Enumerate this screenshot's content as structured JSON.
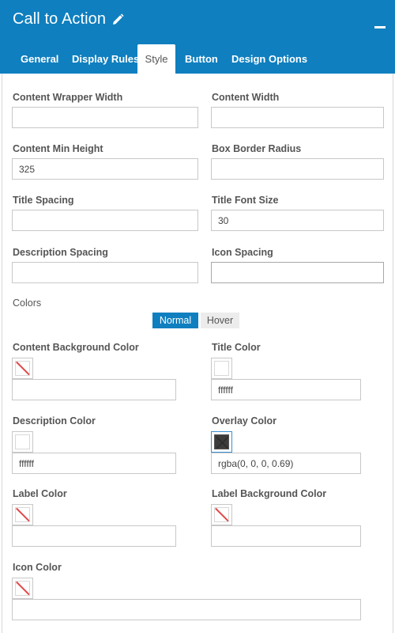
{
  "window": {
    "title": "Call to Action",
    "edit_icon": "pencil-icon",
    "minimize_icon": "minimize-icon"
  },
  "tabs": [
    {
      "label": "General"
    },
    {
      "label": "Display Rules"
    },
    {
      "label": "Style",
      "active": true
    },
    {
      "label": "Button"
    },
    {
      "label": "Design Options"
    }
  ],
  "fields": {
    "content_wrapper_width": {
      "label": "Content Wrapper Width",
      "value": ""
    },
    "content_width": {
      "label": "Content Width",
      "value": ""
    },
    "content_min_height": {
      "label": "Content Min Height",
      "value": "325"
    },
    "box_border_radius": {
      "label": "Box Border Radius",
      "value": ""
    },
    "title_spacing": {
      "label": "Title Spacing",
      "value": ""
    },
    "title_font_size": {
      "label": "Title Font Size",
      "value": "30"
    },
    "description_spacing": {
      "label": "Description Spacing",
      "value": ""
    },
    "icon_spacing": {
      "label": "Icon Spacing",
      "value": ""
    }
  },
  "colors_section": {
    "label": "Colors",
    "toggle": {
      "normal": "Normal",
      "hover": "Hover",
      "selected": "Normal"
    }
  },
  "color_fields": {
    "content_background_color": {
      "label": "Content Background Color",
      "value": "",
      "swatch": "none"
    },
    "title_color": {
      "label": "Title Color",
      "value": "ffffff",
      "swatch": "#ffffff"
    },
    "description_color": {
      "label": "Description Color",
      "value": "ffffff",
      "swatch": "#ffffff"
    },
    "overlay_color": {
      "label": "Overlay Color",
      "value": "rgba(0, 0, 0, 0.69)",
      "swatch": "rgba(0, 0, 0, 0.69)"
    },
    "label_color": {
      "label": "Label Color",
      "value": "",
      "swatch": "none"
    },
    "label_background_color": {
      "label": "Label Background Color",
      "value": "",
      "swatch": "none"
    },
    "icon_color": {
      "label": "Icon Color",
      "value": "",
      "swatch": "none"
    }
  },
  "theme": {
    "accent": "#0f7fbf",
    "border": "#c8c8c8",
    "no_color_slash": "#e04848"
  }
}
